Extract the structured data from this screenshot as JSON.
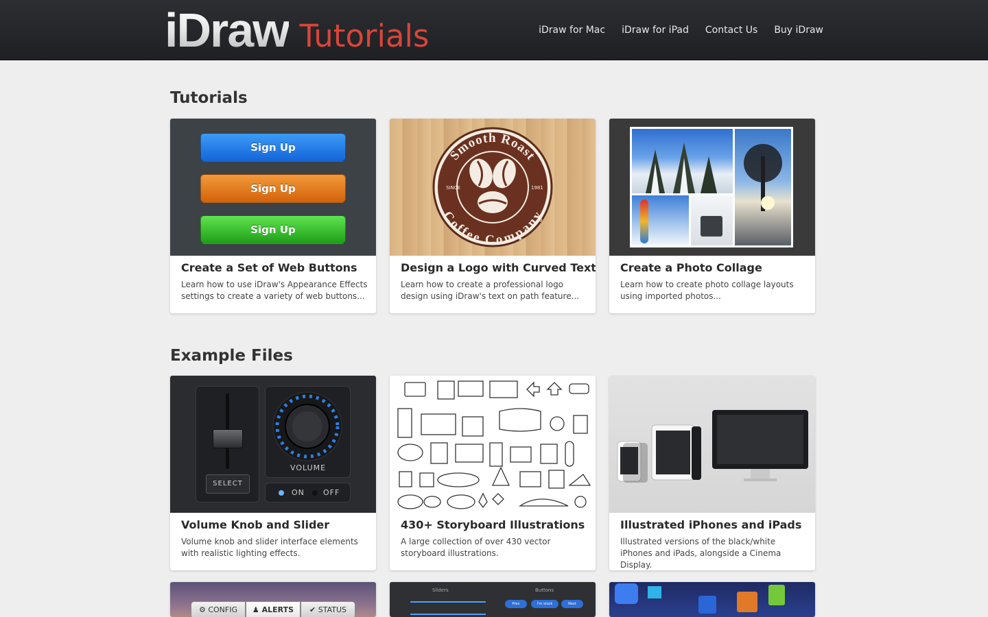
{
  "header": {
    "logo_brand": "iDraw",
    "logo_sub": "Tutorials",
    "nav": [
      "iDraw for Mac",
      "iDraw for iPad",
      "Contact Us",
      "Buy iDraw"
    ]
  },
  "sections": {
    "tutorials_title": "Tutorials",
    "examples_title": "Example Files"
  },
  "tutorials": [
    {
      "title": "Create a Set of Web Buttons",
      "desc": "Learn how to use iDraw's Appearance Effects settings to create a variety of web buttons...",
      "buttons": [
        "Sign Up",
        "Sign Up",
        "Sign Up"
      ]
    },
    {
      "title": "Design a Logo with Curved Text",
      "desc": "Learn how to create a professional logo design using iDraw's text on path feature...",
      "logo_top": "Smooth Roast",
      "logo_bottom": "Coffee Company",
      "since": "SINCE",
      "year": "1981"
    },
    {
      "title": "Create a Photo Collage",
      "desc": "Learn how to create photo collage layouts using imported photos..."
    }
  ],
  "examples": [
    {
      "title": "Volume Knob and Slider",
      "desc": "Volume knob and slider interface elements with realistic lighting effects.",
      "select": "SELECT",
      "volume": "VOLUME",
      "on": "ON",
      "off": "OFF"
    },
    {
      "title": "430+ Storyboard Illustrations",
      "desc": "A large collection of over 430 vector storyboard illustrations."
    },
    {
      "title": "Illustrated iPhones and iPads",
      "desc": "Illustrated versions of the black/white iPhones and iPads, alongside a Cinema Display."
    }
  ],
  "partial": {
    "tabs": [
      "CONFIG",
      "ALERTS",
      "STATUS"
    ],
    "sliders_label": "Sliders",
    "buttons_label": "Buttons",
    "mini_buttons": [
      "Prev",
      "I'm stuck",
      "Next"
    ]
  },
  "colors": {
    "accent_red": "#d9453a",
    "header_bg": "#26282b",
    "page_bg": "#eeeeee"
  }
}
